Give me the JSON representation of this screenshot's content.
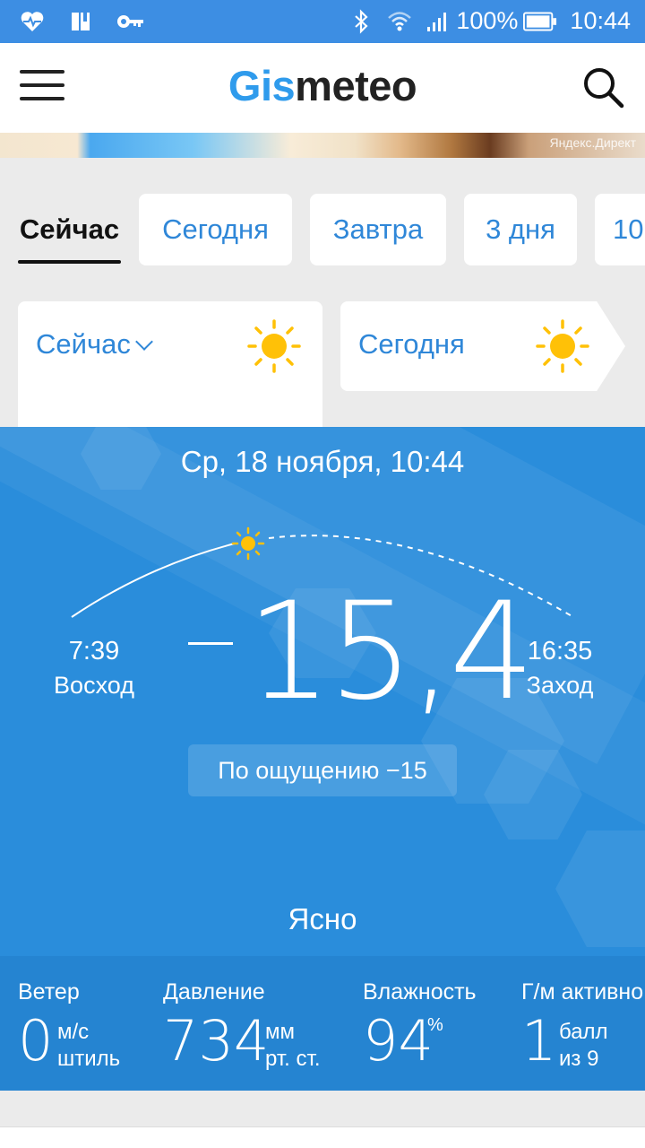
{
  "status_bar": {
    "icons_left": [
      "heartbeat-icon",
      "book-icon",
      "key-icon"
    ],
    "icons_right": [
      "bluetooth-icon",
      "wifi-icon",
      "signal-icon",
      "battery-icon"
    ],
    "battery": "100%",
    "time": "10:44"
  },
  "header": {
    "logo_part1": "Gis",
    "logo_part2": "meteo"
  },
  "ad": {
    "label": "Яндекс.Директ"
  },
  "tabs": [
    {
      "label": "Сейчас",
      "active": true
    },
    {
      "label": "Сегодня"
    },
    {
      "label": "Завтра"
    },
    {
      "label": "3 дня"
    },
    {
      "label": "10"
    }
  ],
  "period_cards": [
    {
      "label": "Сейчас",
      "icon": "sun-icon"
    },
    {
      "label": "Сегодня",
      "icon": "sun-icon"
    }
  ],
  "weather": {
    "datetime": "Ср, 18 ноября, 10:44",
    "temperature": "15,4",
    "temperature_sign": "−",
    "feels_like": "По ощущению −15",
    "condition": "Ясно",
    "sunrise": {
      "time": "7:39",
      "label": "Восход"
    },
    "sunset": {
      "time": "16:35",
      "label": "Заход"
    }
  },
  "stats": {
    "wind": {
      "name": "Ветер",
      "value": "0",
      "unit": "м/с",
      "note": "штиль"
    },
    "pressure": {
      "name": "Давление",
      "value": "734",
      "unit": "мм",
      "note": "рт. ст."
    },
    "humidity": {
      "name": "Влажность",
      "value": "94",
      "unit": "%"
    },
    "geomagnetic": {
      "name": "Г/м активно",
      "value": "1",
      "unit": "балл",
      "note": "из 9"
    }
  },
  "colors": {
    "accent": "#2f87d8",
    "logo_blue": "#2f9bec",
    "status_bar": "#3d8ee3",
    "panel": "#2a8ddb",
    "sun": "#ffc107"
  }
}
